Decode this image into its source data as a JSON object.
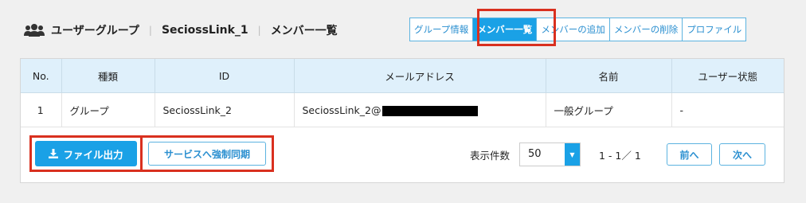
{
  "header": {
    "icon": "users-icon",
    "title": "ユーザーグループ",
    "group_name": "SeciossLink_1",
    "subtitle": "メンバー一覧"
  },
  "tabs": [
    {
      "label": "グループ情報",
      "active": false
    },
    {
      "label": "メンバー一覧",
      "active": true
    },
    {
      "label": "メンバーの追加",
      "active": false
    },
    {
      "label": "メンバーの削除",
      "active": false
    },
    {
      "label": "プロファイル",
      "active": false
    }
  ],
  "table": {
    "headers": [
      "No.",
      "種類",
      "ID",
      "メールアドレス",
      "名前",
      "ユーザー状態"
    ],
    "rows": [
      {
        "no": "1",
        "type": "グループ",
        "id": "SeciossLink_2",
        "email_prefix": "SeciossLink_2@",
        "name": "一般グループ",
        "status": "-"
      }
    ]
  },
  "actions": {
    "export_label": "ファイル出力",
    "force_sync_label": "サービスへ強制同期"
  },
  "pagination": {
    "per_page_label": "表示件数",
    "per_page_value": "50",
    "range_text": "1 - 1／ 1",
    "prev_label": "前へ",
    "next_label": "次へ"
  },
  "colors": {
    "accent": "#1aa1e6",
    "highlight": "#d9301f",
    "table_header_bg": "#dff0fb"
  }
}
